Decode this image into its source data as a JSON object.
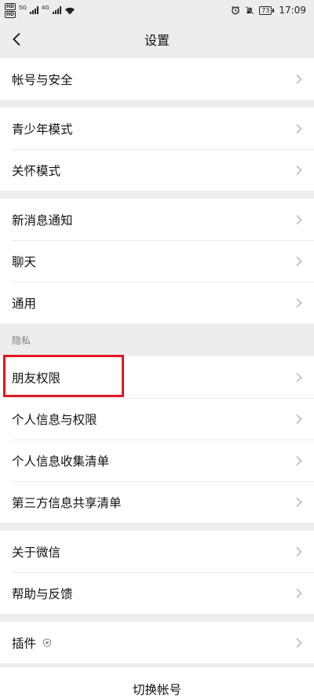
{
  "status_bar": {
    "sim1": "HD",
    "sim2": "HD",
    "net1": "5G",
    "net2": "4G",
    "battery": "73",
    "time": "17:09"
  },
  "navbar": {
    "title": "设置",
    "back_icon": "chevron-left-icon"
  },
  "groups": [
    {
      "items": [
        {
          "label": "帐号与安全"
        }
      ]
    },
    {
      "items": [
        {
          "label": "青少年模式"
        },
        {
          "label": "关怀模式"
        }
      ]
    },
    {
      "items": [
        {
          "label": "新消息通知"
        },
        {
          "label": "聊天"
        },
        {
          "label": "通用"
        }
      ]
    },
    {
      "header": "隐私",
      "items": [
        {
          "label": "朋友权限"
        },
        {
          "label": "个人信息与权限"
        },
        {
          "label": "个人信息收集清单"
        },
        {
          "label": "第三方信息共享清单"
        }
      ]
    },
    {
      "items": [
        {
          "label": "关于微信"
        },
        {
          "label": "帮助与反馈"
        }
      ]
    },
    {
      "items": [
        {
          "label": "插件",
          "icon": "shield-heart-icon"
        }
      ]
    }
  ],
  "switch_account": "切换帐号",
  "colors": {
    "highlight_border": "#e0191f",
    "background": "#ededed"
  }
}
